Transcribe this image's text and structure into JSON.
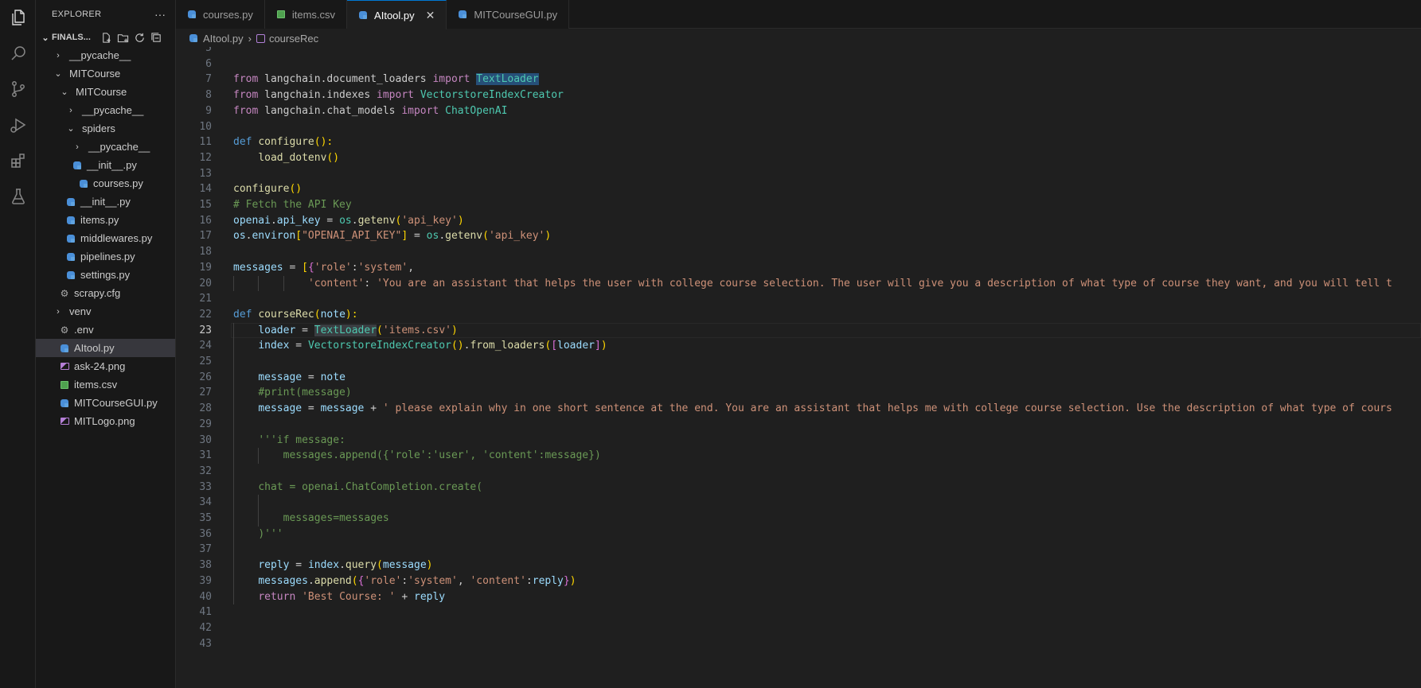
{
  "explorer": {
    "title": "EXPLORER",
    "more": "···",
    "folder_label": "FINALS...",
    "items": [
      {
        "label": "__pycache__",
        "type": "folder",
        "open": false
      },
      {
        "label": "MITCourse",
        "type": "folder",
        "open": true
      },
      {
        "label": "MITCourse",
        "type": "folder",
        "open": true
      },
      {
        "label": "__pycache__",
        "type": "folder",
        "open": false
      },
      {
        "label": "spiders",
        "type": "folder",
        "open": true
      },
      {
        "label": "__pycache__",
        "type": "folder",
        "open": false
      },
      {
        "label": "__init__.py",
        "type": "py"
      },
      {
        "label": "courses.py",
        "type": "py"
      },
      {
        "label": "__init__.py",
        "type": "py"
      },
      {
        "label": "items.py",
        "type": "py"
      },
      {
        "label": "middlewares.py",
        "type": "py"
      },
      {
        "label": "pipelines.py",
        "type": "py"
      },
      {
        "label": "settings.py",
        "type": "py"
      },
      {
        "label": "scrapy.cfg",
        "type": "cfg"
      },
      {
        "label": "venv",
        "type": "folder",
        "open": false
      },
      {
        "label": ".env",
        "type": "cfg"
      },
      {
        "label": "AItool.py",
        "type": "py",
        "selected": true
      },
      {
        "label": "ask-24.png",
        "type": "png"
      },
      {
        "label": "items.csv",
        "type": "csv"
      },
      {
        "label": "MITCourseGUI.py",
        "type": "py"
      },
      {
        "label": "MITLogo.png",
        "type": "png"
      }
    ]
  },
  "tabs": [
    {
      "label": "courses.py",
      "type": "py"
    },
    {
      "label": "items.csv",
      "type": "csv"
    },
    {
      "label": "AItool.py",
      "type": "py",
      "active": true,
      "close": "✕"
    },
    {
      "label": "MITCourseGUI.py",
      "type": "py"
    }
  ],
  "breadcrumb": {
    "file": "AItool.py",
    "symbol": "courseRec"
  },
  "editor": {
    "line_numbers": [
      "5",
      "6",
      "7",
      "8",
      "9",
      "10",
      "11",
      "12",
      "13",
      "14",
      "15",
      "16",
      "17",
      "18",
      "19",
      "20",
      "21",
      "22",
      "23",
      "24",
      "25",
      "26",
      "27",
      "28",
      "29",
      "30",
      "31",
      "32",
      "33",
      "34",
      "35",
      "36",
      "37",
      "38",
      "39",
      "40",
      "41",
      "42",
      "43"
    ],
    "current_line": "23",
    "code": {
      "l7": [
        "from",
        " langchain.document_loaders ",
        "import",
        " ",
        "TextLoader"
      ],
      "l8": [
        "from",
        " langchain.indexes ",
        "import",
        " ",
        "VectorstoreIndexCreator"
      ],
      "l9": [
        "from",
        " langchain.chat_models ",
        "import",
        " ",
        "ChatOpenAI"
      ],
      "l11": [
        "def",
        " ",
        "configure",
        "():"
      ],
      "l12": [
        "load_dotenv",
        "()"
      ],
      "l14": [
        "configure",
        "()"
      ],
      "l15": "# Fetch the API Key",
      "l16": [
        "openai",
        ".",
        "api_key",
        " = ",
        "os",
        ".",
        "getenv",
        "(",
        "'api_key'",
        ")"
      ],
      "l17": [
        "os",
        ".",
        "environ",
        "[",
        "\"OPENAI_API_KEY\"",
        "]",
        " = ",
        "os",
        ".",
        "getenv",
        "(",
        "'api_key'",
        ")"
      ],
      "l19": [
        "messages",
        " = ",
        "[",
        "{",
        "'role'",
        ":",
        "'system'",
        ","
      ],
      "l20": [
        "'content'",
        ": ",
        "'You are an assistant that helps the user with college course selection. The user will give you a description of what type of course they want, and you will tell t"
      ],
      "l22": [
        "def",
        " ",
        "courseRec",
        "(",
        "note",
        "):"
      ],
      "l23": [
        "loader",
        " = ",
        "TextLoader",
        "(",
        "'items.csv'",
        ")"
      ],
      "l24": [
        "index",
        " = ",
        "VectorstoreIndexCreator",
        "()",
        ".",
        "from_loaders",
        "(",
        "[",
        "loader",
        "]",
        ")"
      ],
      "l26": [
        "message",
        " = ",
        "note"
      ],
      "l27": "#print(message)",
      "l28": [
        "message",
        " = ",
        "message",
        " + ",
        "' please explain why in one short sentence at the end. You are an assistant that helps me with college course selection. Use the description of what type of cours"
      ],
      "l30": "'''if message:",
      "l31": "messages.append({'role':'user', 'content':message})",
      "l33": "chat = openai.ChatCompletion.create(",
      "l35": "messages=messages",
      "l36": ")'''",
      "l38": [
        "reply",
        " = ",
        "index",
        ".",
        "query",
        "(",
        "message",
        ")"
      ],
      "l39": [
        "messages",
        ".",
        "append",
        "(",
        "{",
        "'role'",
        ":",
        "'system'",
        ", ",
        "'content'",
        ":",
        "reply",
        "}",
        ")"
      ],
      "l40": [
        "return",
        " ",
        "'Best Course: '",
        " + ",
        "reply"
      ]
    }
  },
  "activity_icons": [
    "explorer-icon",
    "search-icon",
    "source-control-icon",
    "run-debug-icon",
    "extensions-icon",
    "testing-icon"
  ]
}
